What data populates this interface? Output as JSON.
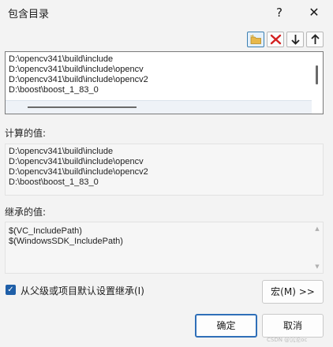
{
  "window": {
    "title": "包含目录",
    "help_label": "?",
    "close_label": "✕"
  },
  "toolbar": [
    {
      "name": "new-line-button",
      "icon": "folder-new-icon"
    },
    {
      "name": "delete-button",
      "icon": "delete-x-icon"
    },
    {
      "name": "move-down-button",
      "icon": "arrow-down-icon"
    },
    {
      "name": "move-up-button",
      "icon": "arrow-up-icon"
    }
  ],
  "include_dirs": [
    "D:\\opencv341\\build\\include",
    "D:\\opencv341\\build\\include\\opencv",
    "D:\\opencv341\\build\\include\\opencv2",
    "D:\\boost\\boost_1_83_0"
  ],
  "computed": {
    "label": "计算的值:",
    "lines": [
      "D:\\opencv341\\build\\include",
      "D:\\opencv341\\build\\include\\opencv",
      "D:\\opencv341\\build\\include\\opencv2",
      "D:\\boost\\boost_1_83_0"
    ]
  },
  "inherited": {
    "label": "继承的值:",
    "lines": [
      "$(VC_IncludePath)",
      "$(WindowsSDK_IncludePath)"
    ]
  },
  "inherit_checkbox": {
    "label": "从父级或项目默认设置继承(I)",
    "checked": true
  },
  "buttons": {
    "macro": "宏(M) >>",
    "ok": "确定",
    "cancel": "取消"
  },
  "watermark": "CSDN @沉沦oc",
  "colors": {
    "accent": "#2f6fb8",
    "delete_red": "#d32020"
  }
}
